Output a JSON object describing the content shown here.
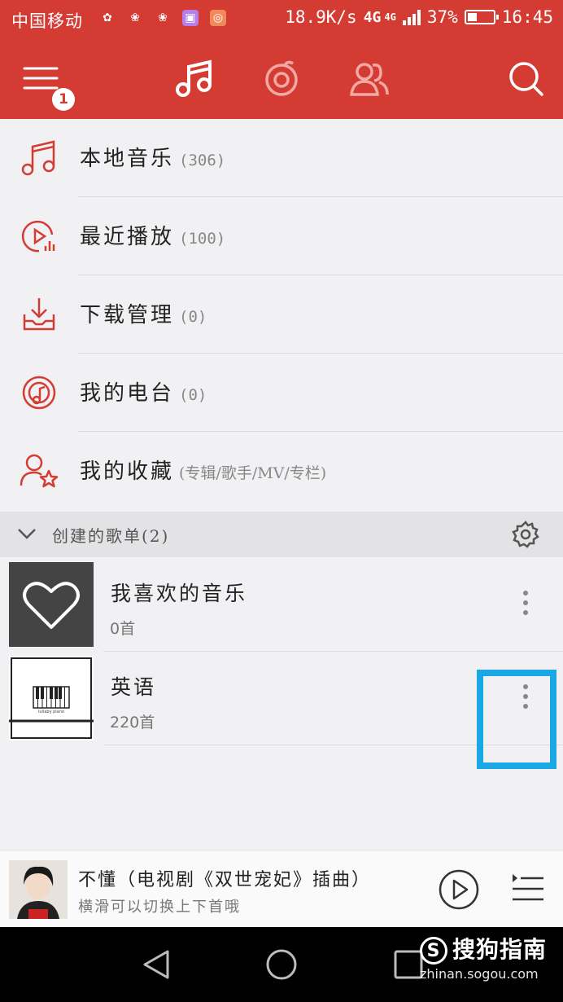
{
  "status_bar": {
    "carrier": "中国移动",
    "net_speed": "18.9K/s",
    "network": "4G",
    "network_small": "4G",
    "battery": "37%",
    "battery_level": 0.37,
    "time": "16:45"
  },
  "top_bar": {
    "badge_count": "1",
    "icons": [
      "menu-icon",
      "music-note-icon",
      "netease-logo-icon",
      "friends-icon",
      "search-icon"
    ]
  },
  "menu": [
    {
      "label": "本地音乐",
      "count": "(306)",
      "icon": "music-note-icon"
    },
    {
      "label": "最近播放",
      "count": "(100)",
      "icon": "recent-play-icon"
    },
    {
      "label": "下载管理",
      "count": "(0)",
      "icon": "download-icon"
    },
    {
      "label": "我的电台",
      "count": "(0)",
      "icon": "radio-icon"
    },
    {
      "label": "我的收藏",
      "count": "(专辑/歌手/MV/专栏)",
      "icon": "favorite-user-star-icon"
    }
  ],
  "section": {
    "title": "创建的歌单(2)"
  },
  "playlists": [
    {
      "name": "我喜欢的音乐",
      "sub": "0首",
      "cover": "heart-icon"
    },
    {
      "name": "英语",
      "sub": "220首",
      "cover": "piano-icon",
      "cover_caption": "lullaby piano"
    }
  ],
  "player": {
    "song": "不懂（电视剧《双世宠妃》插曲）",
    "hint": "横滑可以切换上下首哦"
  },
  "watermark": {
    "brand": "搜狗指南",
    "url": "zhinan.sogou.com"
  },
  "colors": {
    "accent": "#d43c33",
    "highlight": "#1aa7e6"
  }
}
